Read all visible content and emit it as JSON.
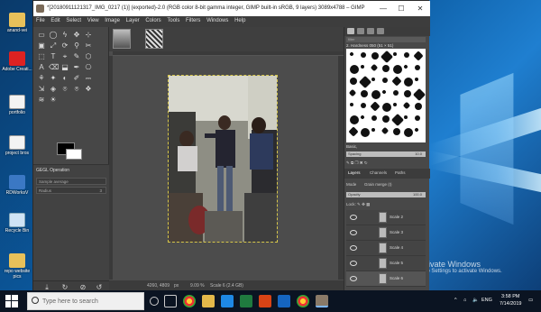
{
  "desktop": {
    "icons": [
      {
        "label": "anand-vei"
      },
      {
        "label": "Adobe Creati..."
      },
      {
        "label": "portfolio"
      },
      {
        "label": "project bros"
      },
      {
        "label": "RDWorksV"
      },
      {
        "label": "Recycle Bin"
      },
      {
        "label": "repo website pics"
      }
    ],
    "activate_title": "Activate Windows",
    "activate_sub": "Go to Settings to activate Windows."
  },
  "window": {
    "title": "*[20180911121317_IMG_0217 (1)] (exported)-2.0 (RGB color 8-bit gamma integer, GIMP built-in sRGB, 9 layers) 3089x4788 – GIMP",
    "min": "—",
    "max": "☐",
    "close": "✕"
  },
  "menu": [
    "File",
    "Edit",
    "Select",
    "View",
    "Image",
    "Layer",
    "Colors",
    "Tools",
    "Filters",
    "Windows",
    "Help"
  ],
  "toolbox": {
    "options_title": "GEGL Operation",
    "options_hint": "Sample average",
    "radius_label": "Radius",
    "radius_value": "3"
  },
  "status": {
    "coords": "4260, 4809",
    "unit": "px",
    "zoom": "9.09 %",
    "layer_info": "Scale 6 (2.4 GB)"
  },
  "dock": {
    "filter_placeholder": "filter",
    "brush_name": "2. Hardness 050 (51 × 51)",
    "preset_name": "Basic,",
    "spacing_label": "Spacing",
    "spacing_value": "10.0",
    "tabs": [
      "Layers",
      "Channels",
      "Paths"
    ],
    "mode_label": "Mode",
    "mode_value": "Grain merge (I)",
    "opacity_label": "Opacity",
    "opacity_value": "100.0",
    "lock_label": "Lock:",
    "layers": [
      "Scale 2",
      "Scale 3",
      "Scale 4",
      "Scale 5",
      "Scale 6"
    ]
  },
  "taskbar": {
    "search_placeholder": "Type here to search",
    "time": "3:58 PM",
    "date": "7/14/2019",
    "lang": "ENG"
  }
}
